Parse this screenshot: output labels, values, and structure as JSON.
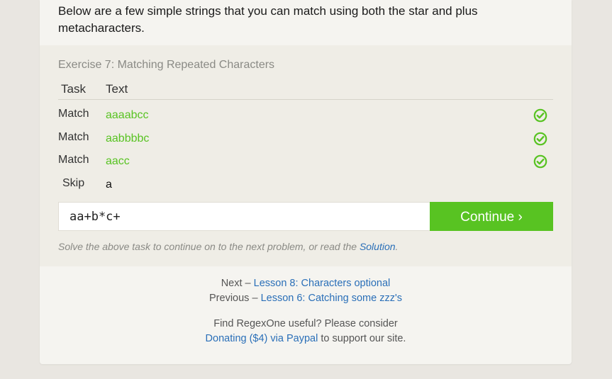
{
  "intro": {
    "text": "Below are a few simple strings that you can match using both the star and plus metacharacters."
  },
  "exercise": {
    "title": "Exercise 7: Matching Repeated Characters",
    "headers": {
      "task": "Task",
      "text": "Text"
    },
    "rows": [
      {
        "task": "Match",
        "text": "aaaabcc",
        "status": "check-icon"
      },
      {
        "task": "Match",
        "text": "aabbbbc",
        "status": "check-icon"
      },
      {
        "task": "Match",
        "text": "aacc",
        "status": "check-icon"
      },
      {
        "task": "Skip",
        "text": "a",
        "status": ""
      }
    ],
    "input_value": "aa+b*c+",
    "continue_label": "Continue ›",
    "hint_prefix": "Solve the above task to continue on to the next problem, or read the ",
    "hint_link": "Solution",
    "hint_suffix": "."
  },
  "footer": {
    "next_prefix": "Next – ",
    "next_link": "Lesson 8: Characters optional",
    "previous_prefix": "Previous – ",
    "previous_link": "Lesson 6: Catching some zzz's",
    "useful_text": "Find RegexOne useful? Please consider",
    "donate_link": "Donating ($4) via Paypal",
    "donate_suffix": " to support our site."
  },
  "colors": {
    "accent_green": "#58c322",
    "link_blue": "#2a6fb8",
    "panel_bg": "#efede6",
    "card_bg": "#f5f4f0"
  }
}
